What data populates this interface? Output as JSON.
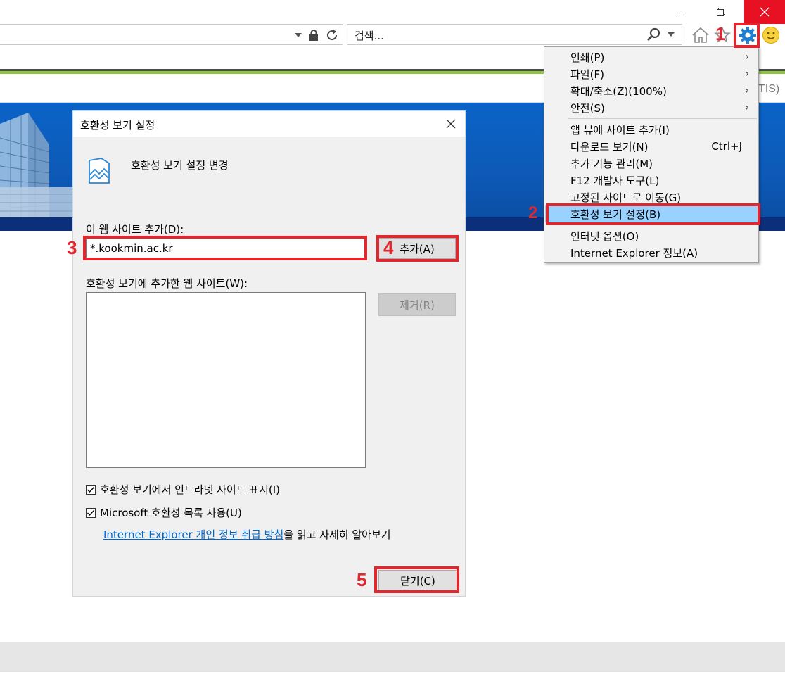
{
  "toolbar": {
    "search_placeholder": "검색..."
  },
  "page": {
    "partial_text": "TIS)"
  },
  "annotations": [
    "1",
    "2",
    "3",
    "4",
    "5"
  ],
  "menu": {
    "items": [
      {
        "label": "인쇄(P)",
        "submenu": true
      },
      {
        "label": "파일(F)",
        "submenu": true
      },
      {
        "label": "확대/축소(Z)(100%)",
        "submenu": true
      },
      {
        "label": "안전(S)",
        "submenu": true
      },
      {
        "label": "앱 뷰에 사이트 추가(I)"
      },
      {
        "label": "다운로드 보기(N)",
        "shortcut": "Ctrl+J"
      },
      {
        "label": "추가 기능 관리(M)"
      },
      {
        "label": "F12 개발자 도구(L)"
      },
      {
        "label": "고정된 사이트로 이동(G)"
      },
      {
        "label": "호환성 보기 설정(B)",
        "highlighted": true
      },
      {
        "label": "인터넷 옵션(O)"
      },
      {
        "label": "Internet Explorer 정보(A)"
      }
    ]
  },
  "dialog": {
    "title": "호환성 보기 설정",
    "heading": "호환성 보기 설정 변경",
    "add_label": "이 웹 사이트 추가(D):",
    "add_value": "*.kookmin.ac.kr",
    "add_button": "추가(A)",
    "list_label": "호환성 보기에 추가한 웹 사이트(W):",
    "remove_button": "제거(R)",
    "checkbox1": {
      "label": "호환성 보기에서 인트라넷 사이트 표시(I)",
      "checked": true
    },
    "checkbox2": {
      "label": "Microsoft 호환성 목록 사용(U)",
      "checked": true
    },
    "link_text": "Internet Explorer 개인 정보 취급 방침",
    "link_suffix": "을 읽고 자세히 알아보기",
    "close_button": "닫기(C)"
  },
  "colors": {
    "annotation_red": "#e2262e",
    "menu_highlight": "#99d1ff",
    "banner_blue": "#0a63c7",
    "accent_green": "#8cc63f"
  }
}
